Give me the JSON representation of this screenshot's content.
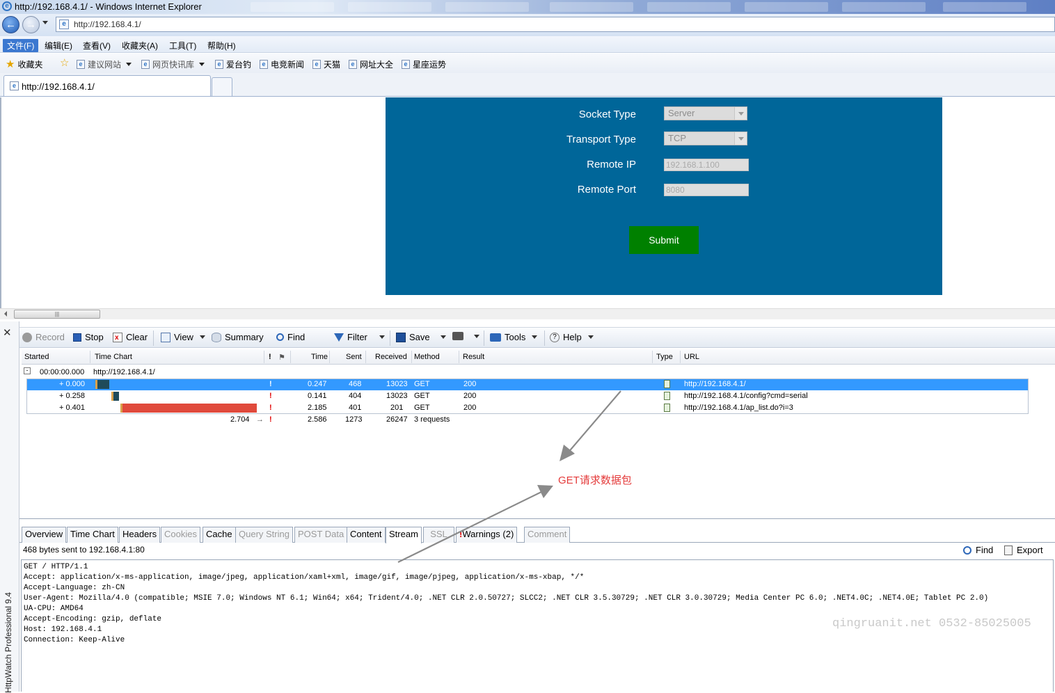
{
  "window": {
    "title": "http://192.168.4.1/ - Windows Internet Explorer",
    "address": "http://192.168.4.1/",
    "tab_title": "http://192.168.4.1/"
  },
  "menu": [
    "文件(F)",
    "编辑(E)",
    "查看(V)",
    "收藏夹(A)",
    "工具(T)",
    "帮助(H)"
  ],
  "favorites": {
    "label": "收藏夹",
    "items": [
      "建议网站",
      "网页快讯库",
      "爱台钓",
      "电竞新闻",
      "天猫",
      "网址大全",
      "星座运势"
    ]
  },
  "form": {
    "socket_type_label": "Socket Type",
    "socket_type_value": "Server",
    "transport_type_label": "Transport Type",
    "transport_type_value": "TCP",
    "remote_ip_label": "Remote IP",
    "remote_ip_value": "192.168.1.100",
    "remote_port_label": "Remote Port",
    "remote_port_value": "8080",
    "submit_label": "Submit"
  },
  "httpwatch": {
    "sidebar_title": "HttpWatch Professional 9.4",
    "toolbar": {
      "record": "Record",
      "stop": "Stop",
      "clear": "Clear",
      "view": "View",
      "summary": "Summary",
      "find": "Find",
      "filter": "Filter",
      "save": "Save",
      "tools": "Tools",
      "help": "Help"
    },
    "columns": [
      "Started",
      "Time Chart",
      "!",
      "Time",
      "Sent",
      "Received",
      "Method",
      "Result",
      "Type",
      "URL"
    ],
    "group": {
      "started": "00:00:00.000",
      "url": "http://192.168.4.1/"
    },
    "rows": [
      {
        "started": "+ 0.000",
        "flag": "!",
        "time": "0.247",
        "sent": "468",
        "received": "13023",
        "method": "GET",
        "result": "200",
        "url": "http://192.168.4.1/"
      },
      {
        "started": "+ 0.258",
        "flag": "!",
        "time": "0.141",
        "sent": "404",
        "received": "13023",
        "method": "GET",
        "result": "200",
        "url": "http://192.168.4.1/config?cmd=serial"
      },
      {
        "started": "+ 0.401",
        "flag": "!",
        "time": "2.185",
        "sent": "401",
        "received": "201",
        "method": "GET",
        "result": "200",
        "url": "http://192.168.4.1/ap_list.do?i=3"
      }
    ],
    "summary_row": {
      "total_time": "2.704",
      "flag": "!",
      "time": "2.586",
      "sent": "1273",
      "received": "26247",
      "requests": "3 requests"
    },
    "detail_tabs": [
      "Overview",
      "Time Chart",
      "Headers",
      "Cookies",
      "Cache",
      "Query String",
      "POST Data",
      "Content",
      "Stream",
      "SSL",
      "Warnings (2)",
      "Comment"
    ],
    "stream_info": "468 bytes sent to 192.168.4.1:80",
    "find_label": "Find",
    "export_label": "Export",
    "stream_text": "GET / HTTP/1.1\nAccept: application/x-ms-application, image/jpeg, application/xaml+xml, image/gif, image/pjpeg, application/x-ms-xbap, */*\nAccept-Language: zh-CN\nUser-Agent: Mozilla/4.0 (compatible; MSIE 7.0; Windows NT 6.1; Win64; x64; Trident/4.0; .NET CLR 2.0.50727; SLCC2; .NET CLR 3.5.30729; .NET CLR 3.0.30729; Media Center PC 6.0; .NET4.0C; .NET4.0E; Tablet PC 2.0)\nUA-CPU: AMD64\nAccept-Encoding: gzip, deflate\nHost: 192.168.4.1\nConnection: Keep-Alive"
  },
  "annotation": "GET请求数据包",
  "watermark": "qingruanit.net 0532-85025005",
  "colors": {
    "form_panel": "#006699",
    "submit": "#008000",
    "selected_row": "#3399ff",
    "annotation": "#e43b3b",
    "long_bar": "#e04a3c"
  }
}
